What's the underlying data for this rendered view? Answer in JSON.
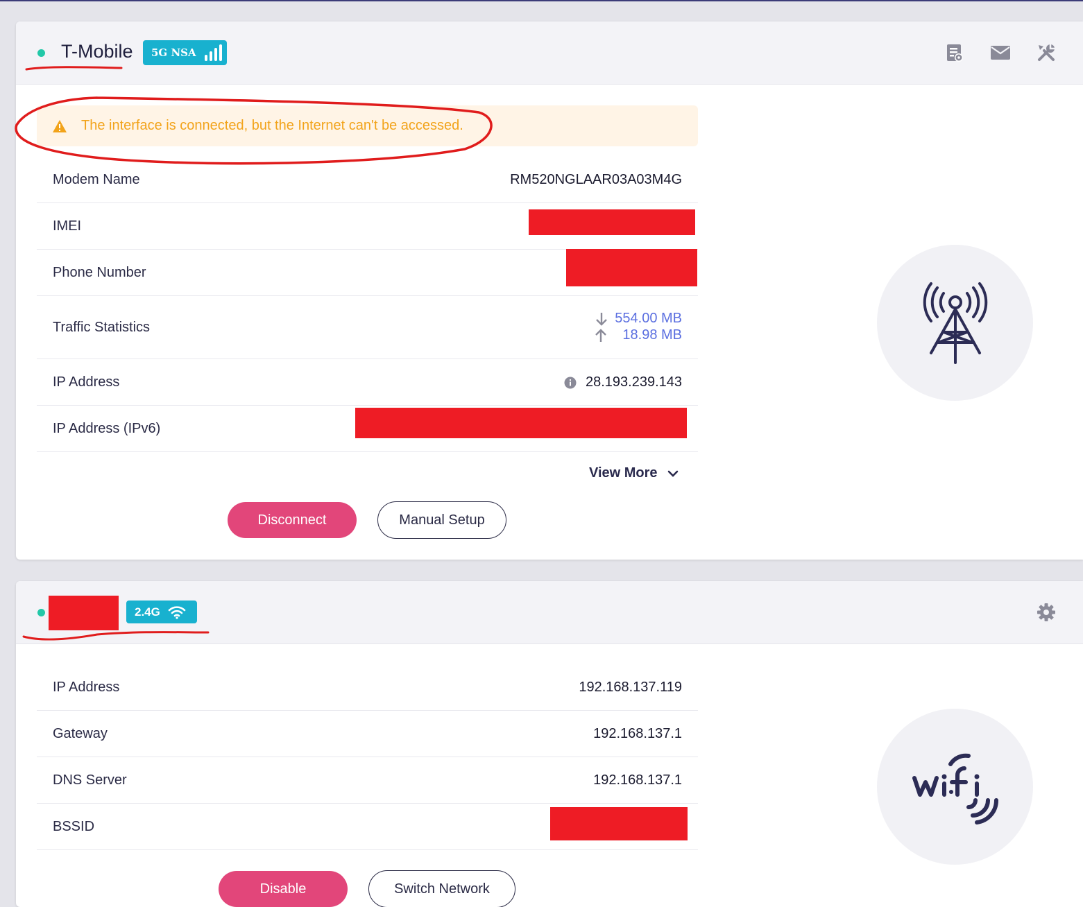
{
  "modem_card": {
    "title": "T-Mobile",
    "badge_text": "5G NSA",
    "alert": "The interface is connected, but the Internet can't be accessed.",
    "rows": [
      {
        "label": "Modem Name",
        "value": "RM520NGLAAR03A03M4G"
      },
      {
        "label": "IMEI",
        "value": ""
      },
      {
        "label": "Phone Number",
        "value": ""
      },
      {
        "label": "Traffic Statistics",
        "download": "554.00 MB",
        "upload": "18.98 MB"
      },
      {
        "label": "IP Address",
        "value": "28.193.239.143"
      },
      {
        "label": "IP Address (IPv6)",
        "value": ""
      }
    ],
    "view_more": "View More",
    "disconnect": "Disconnect",
    "manual_setup": "Manual Setup",
    "icons": [
      "sim-settings-icon",
      "mail-icon",
      "tools-icon",
      "cell-tower-icon"
    ]
  },
  "wifi_card": {
    "badge_text": "2.4G",
    "rows": [
      {
        "label": "IP Address",
        "value": "192.168.137.119"
      },
      {
        "label": "Gateway",
        "value": "192.168.137.1"
      },
      {
        "label": "DNS Server",
        "value": "192.168.137.1"
      },
      {
        "label": "BSSID",
        "value": ""
      }
    ],
    "disable": "Disable",
    "switch_network": "Switch Network",
    "icons": [
      "gear-icon",
      "wifi-logo-icon"
    ]
  },
  "colors": {
    "accent_pink": "#e2467a",
    "badge_cyan": "#18b1cf",
    "status_green": "#22c8a8",
    "warning_orange": "#f2a31a",
    "traffic_blue": "#5b6fe0",
    "redaction": "#ee1c25"
  }
}
